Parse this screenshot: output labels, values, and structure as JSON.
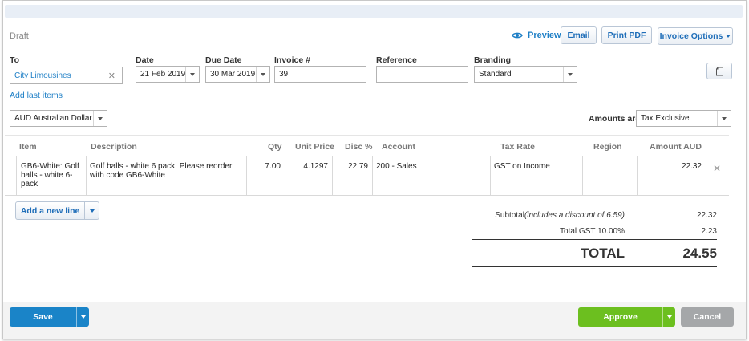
{
  "status": "Draft",
  "toolbar": {
    "preview": "Preview",
    "email": "Email",
    "print_pdf": "Print PDF",
    "invoice_options": "Invoice Options"
  },
  "form": {
    "to_label": "To",
    "to_value": "City Limousines",
    "date_label": "Date",
    "date_value": "21 Feb 2019",
    "due_label": "Due Date",
    "due_value": "30 Mar 2019",
    "invoice_label": "Invoice #",
    "invoice_value": "39",
    "reference_label": "Reference",
    "reference_value": "",
    "branding_label": "Branding",
    "branding_value": "Standard",
    "add_last_items": "Add last items",
    "currency": "AUD Australian Dollar",
    "amounts_are_label": "Amounts are",
    "amounts_are_value": "Tax Exclusive"
  },
  "table": {
    "headers": {
      "item": "Item",
      "description": "Description",
      "qty": "Qty",
      "unit_price": "Unit Price",
      "disc": "Disc %",
      "account": "Account",
      "tax_rate": "Tax Rate",
      "region": "Region",
      "amount": "Amount AUD"
    },
    "rows": [
      {
        "item": "GB6-White: Golf balls - white 6-pack",
        "description": "Golf balls - white 6 pack. Please reorder with code GB6-White",
        "qty": "7.00",
        "unit_price": "4.1297",
        "disc": "22.79",
        "account": "200 - Sales",
        "tax_rate": "GST on Income",
        "region": "",
        "amount": "22.32"
      }
    ]
  },
  "add_line": "Add a new line",
  "totals": {
    "subtotal_label": "Subtotal",
    "subtotal_note": "(includes a discount of 6.59)",
    "subtotal_value": "22.32",
    "gst_label": "Total GST 10.00%",
    "gst_value": "2.23",
    "total_label": "TOTAL",
    "total_value": "24.55"
  },
  "footer": {
    "save": "Save",
    "approve": "Approve",
    "cancel": "Cancel"
  },
  "colors": {
    "link_blue": "#1e7fc6",
    "save_blue": "#1a84c8",
    "approve_green": "#6cbf1f",
    "cancel_gray": "#a5a7a9"
  },
  "icons": {
    "preview": "eye-icon",
    "copy": "copy-icon",
    "clear": "close-icon",
    "delete_row": "close-icon",
    "drag": "drag-handle-icon",
    "dropdown": "chevron-down-icon"
  }
}
